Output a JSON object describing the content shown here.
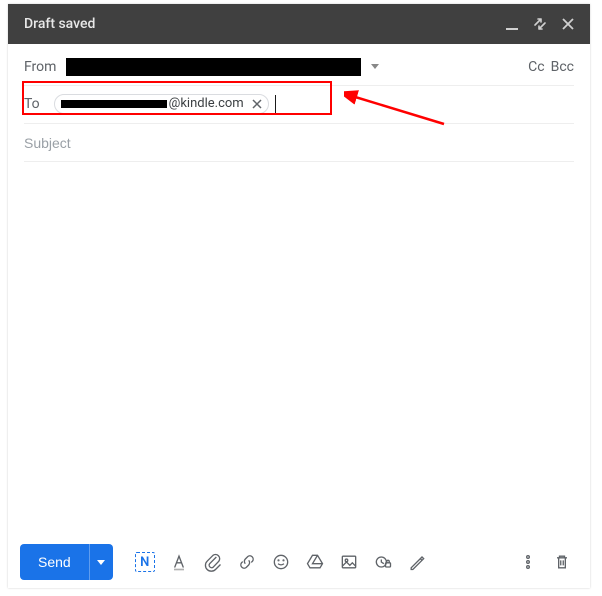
{
  "titlebar": {
    "title": "Draft saved"
  },
  "from": {
    "label": "From"
  },
  "ccbcc": {
    "cc": "Cc",
    "bcc": "Bcc"
  },
  "to": {
    "label": "To",
    "chip_domain": "@kindle.com"
  },
  "subject": {
    "placeholder": "Subject",
    "value": ""
  },
  "toolbar": {
    "send_label": "Send",
    "compose_n": "N"
  }
}
